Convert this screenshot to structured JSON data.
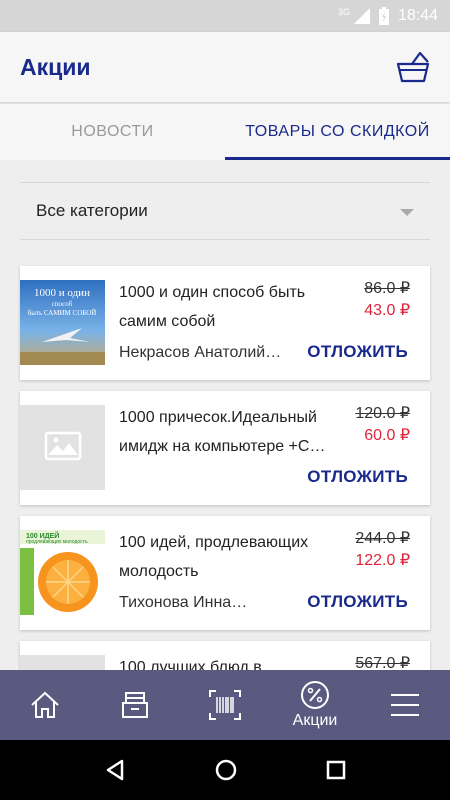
{
  "status": {
    "network": "3G",
    "time": "18:44"
  },
  "appbar": {
    "title": "Акции",
    "cart_icon": "basket-icon"
  },
  "tabs": [
    {
      "label": "НОВОСТИ"
    },
    {
      "label": "ТОВАРЫ СО СКИДКОЙ"
    }
  ],
  "category": {
    "selected": "Все категории"
  },
  "products": [
    {
      "name": "1000 и один способ быть самим собой",
      "author": "Некрасов Анатолий…",
      "old_price": "86.0 ₽",
      "new_price": "43.0 ₽",
      "action": "ОТЛОЖИТЬ",
      "cover_lines": [
        "1000 и один",
        "способ",
        "быть САМИМ СОБОЙ"
      ]
    },
    {
      "name": "1000 причесок.Идеальный имидж на компьютере +С…",
      "author": "",
      "old_price": "120.0 ₽",
      "new_price": "60.0 ₽",
      "action": "ОТЛОЖИТЬ"
    },
    {
      "name": "100 идей, продлевающих молодость",
      "author": "Тихонова Инна…",
      "old_price": "244.0 ₽",
      "new_price": "122.0 ₽",
      "action": "ОТЛОЖИТЬ",
      "cover_lines": [
        "100 ИДЕЙ",
        "продлевающих молодость"
      ]
    },
    {
      "name": "100 лучших блюд в",
      "old_price": "567.0 ₽"
    }
  ],
  "bottom_nav": [
    {
      "icon": "home-icon",
      "label": ""
    },
    {
      "icon": "catalog-icon",
      "label": ""
    },
    {
      "icon": "barcode-icon",
      "label": ""
    },
    {
      "icon": "percent-icon",
      "label": "Акции"
    },
    {
      "icon": "menu-icon",
      "label": ""
    }
  ],
  "colors": {
    "accent": "#1a2a8c",
    "sale": "#e0253a",
    "nav_bg": "#5a5a80"
  }
}
